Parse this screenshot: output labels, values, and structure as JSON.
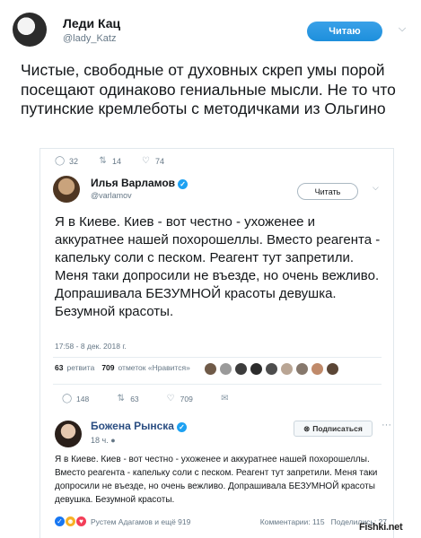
{
  "outer": {
    "name": "Леди Кац",
    "handle": "@lady_Katz",
    "follow_label": "Читаю",
    "text": "Чистые, свободные от духовных скреп умы порой посещают одинаково гениальные мысли. Не то что путинские кремлеботы с методичками из Ольгино"
  },
  "embed": {
    "stats": {
      "replies": "32",
      "retweets": "14",
      "likes": "74"
    },
    "author": {
      "name": "Илья Варламов",
      "handle": "@varlamov",
      "read_label": "Читать"
    },
    "text": "Я в Киеве. Киев - вот честно - ухоженее и аккуратнее нашей похорошеллы. Вместо реагента - капельку соли с песком. Реагент тут запретили. Меня таки допросили не въезде, но очень вежливо. Допрашивала БЕЗУМНОЙ красоты девушка. Безумной красоты.",
    "timestamp": "17:58 - 8 дек. 2018 г.",
    "retweets_count": "63",
    "retweets_word": "ретвита",
    "likes_count": "709",
    "likes_word": "отметок «Нравится»",
    "actions": {
      "replies": "148",
      "retweets": "63",
      "likes": "709"
    }
  },
  "repost": {
    "name": "Божена Рынска",
    "time": "18 ч.",
    "subscribe_label": "Подписаться",
    "text": "Я в Киеве. Киев - вот честно - ухоженее и аккуратнее нашей похорошеллы. Вместо реагента - капельку соли с песком. Реагент тут запретили. Меня таки допросили не въезде, но очень вежливо. Допрашивала БЕЗУМНОЙ красоты девушка. Безумной красоты.",
    "reactions_text": "Рустем Адагамов и ещё 919",
    "comments_text": "Комментарии: 115",
    "shares_text": "Поделились: 27"
  },
  "watermark": "Fishki.net",
  "colors": {
    "twitter_blue": "#1da1f2",
    "fb_name": "#2b4e82"
  }
}
